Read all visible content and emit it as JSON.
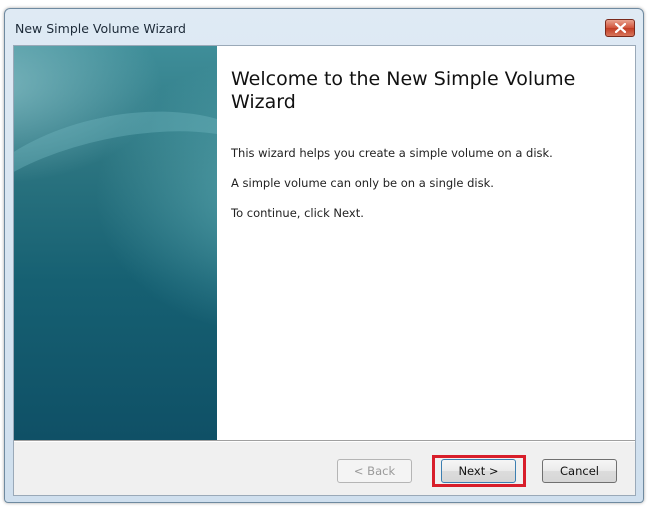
{
  "window": {
    "title": "New Simple Volume Wizard"
  },
  "page": {
    "heading": "Welcome to the New Simple Volume Wizard",
    "paragraphs": [
      "This wizard helps you create a simple volume on a disk.",
      "A simple volume can only be on a single disk.",
      "To continue, click Next."
    ]
  },
  "buttons": {
    "back": "< Back",
    "next": "Next >",
    "cancel": "Cancel"
  },
  "colors": {
    "highlight": "#d81e2a",
    "banner": "#166072"
  }
}
